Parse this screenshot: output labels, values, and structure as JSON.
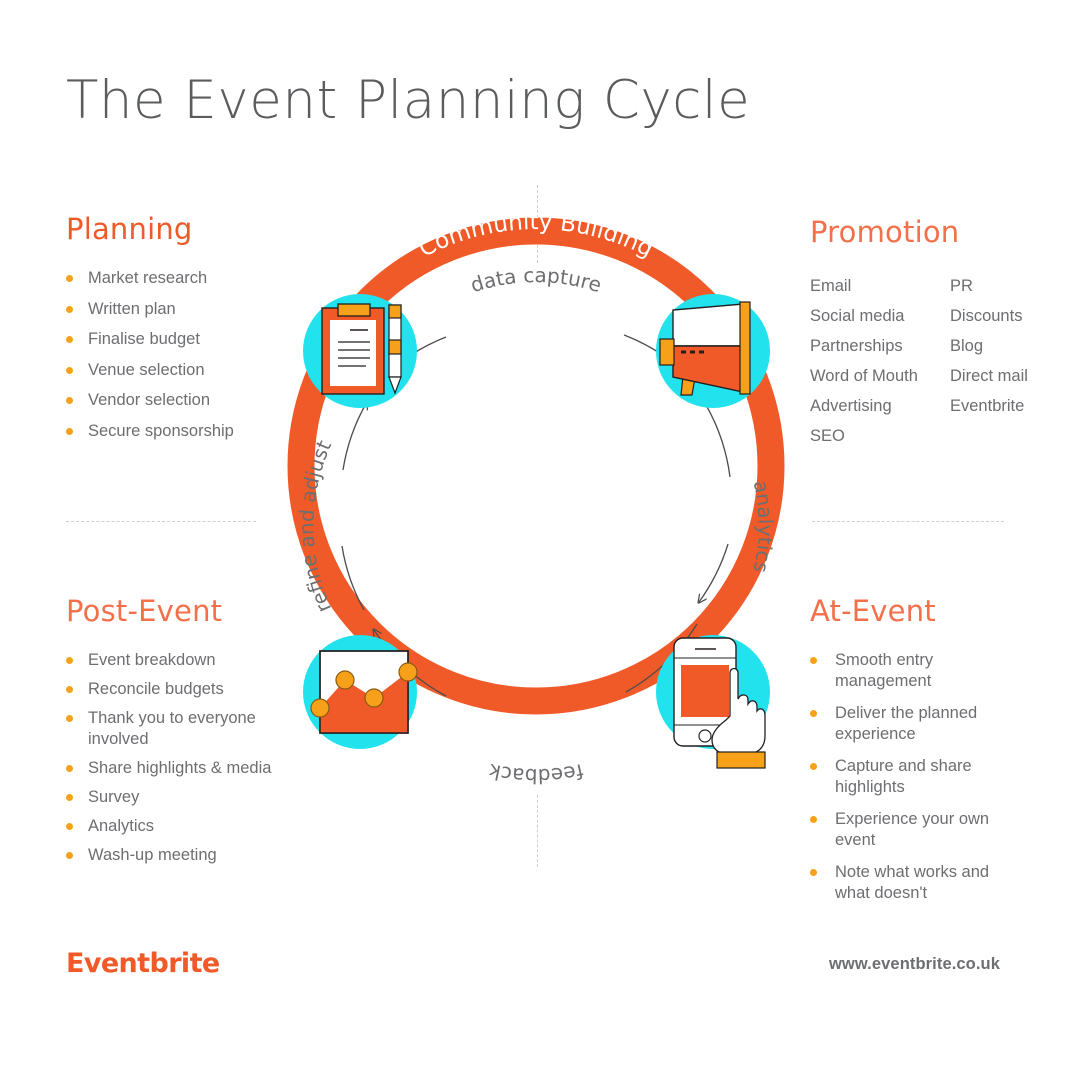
{
  "title": "The Event Planning Cycle",
  "colors": {
    "orange": "#f05a28",
    "amber": "#f7a11a",
    "cyan": "#22e2ee",
    "text_gray": "#6d6e71",
    "title_gray": "#5b5c5e",
    "dash_gray": "#cfd0d1"
  },
  "quadrants": {
    "planning": {
      "heading": "Planning",
      "items": [
        "Market research",
        "Written plan",
        "Finalise budget",
        "Venue selection",
        "Vendor selection",
        "Secure sponsorship"
      ]
    },
    "promotion": {
      "heading": "Promotion",
      "column_a": [
        "Email",
        "Social media",
        "Partnerships",
        "Word of Mouth",
        "Advertising",
        "SEO"
      ],
      "column_b": [
        "PR",
        "Discounts",
        "Blog",
        "Direct mail",
        "Eventbrite"
      ]
    },
    "post_event": {
      "heading": "Post-Event",
      "items": [
        "Event breakdown",
        "Reconcile budgets",
        "Thank you to everyone involved",
        "Share highlights & media",
        "Survey",
        "Analytics",
        "Wash-up meeting"
      ]
    },
    "at_event": {
      "heading": "At-Event",
      "items": [
        "Smooth entry management",
        "Deliver the planned experience",
        "Capture and share highlights",
        "Experience your own event",
        "Note what works and what doesn't"
      ]
    }
  },
  "cycle": {
    "ring_label": "Community Building",
    "arc_labels": {
      "top": "data capture",
      "right": "analytics",
      "bottom": "feedback",
      "left": "refine and adjust"
    },
    "nodes": [
      {
        "name": "clipboard-pencil-icon",
        "position": "top-left"
      },
      {
        "name": "megaphone-icon",
        "position": "top-right"
      },
      {
        "name": "mobile-phone-tap-icon",
        "position": "bottom-right"
      },
      {
        "name": "area-chart-icon",
        "position": "bottom-left"
      }
    ]
  },
  "footer": {
    "brand": "Eventbrite",
    "url": "www.eventbrite.co.uk"
  }
}
